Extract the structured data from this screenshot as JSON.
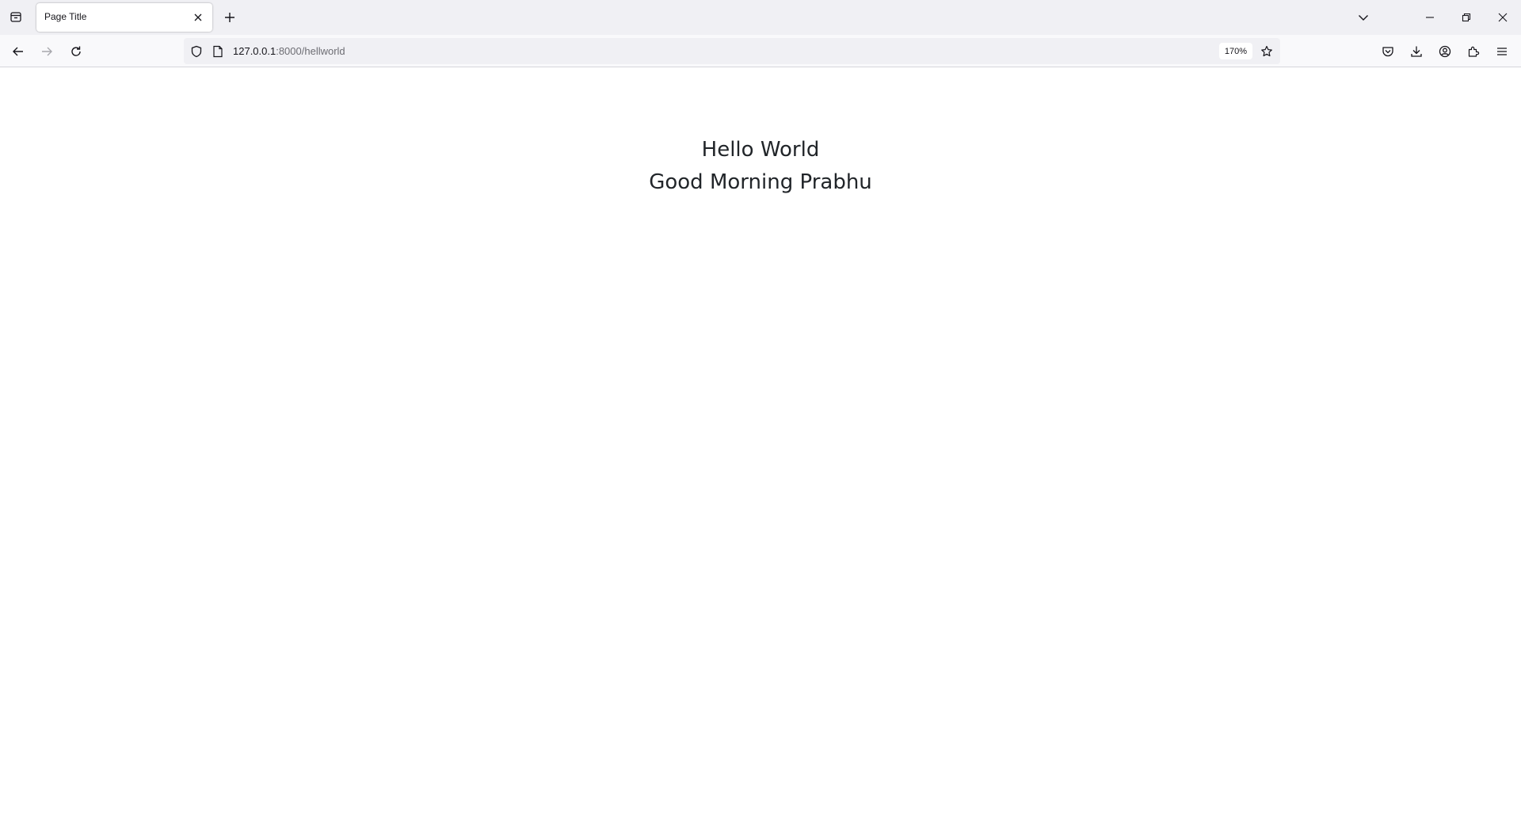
{
  "browser": {
    "tab": {
      "title": "Page Title"
    },
    "url": {
      "host": "127.0.0.1",
      "path": ":8000/hellworld"
    },
    "zoom_level": "170%",
    "icons": {
      "list_all_tabs": "tab-overview-icon",
      "tab_close": "close-icon",
      "new_tab": "plus-icon",
      "list_tabs": "chevron-down-icon",
      "window_minimize": "minimize-icon",
      "window_restore": "restore-icon",
      "window_close": "close-icon",
      "back": "arrow-left-icon",
      "forward": "arrow-right-icon",
      "reload": "reload-icon",
      "tracking_protection": "shield-icon",
      "page_info": "page-icon",
      "bookmark": "star-icon",
      "pocket": "pocket-icon",
      "downloads": "download-icon",
      "account": "account-icon",
      "extensions": "puzzle-icon",
      "app_menu": "hamburger-menu-icon"
    }
  },
  "page": {
    "line1": "Hello World",
    "line2": "Good Morning Prabhu"
  }
}
